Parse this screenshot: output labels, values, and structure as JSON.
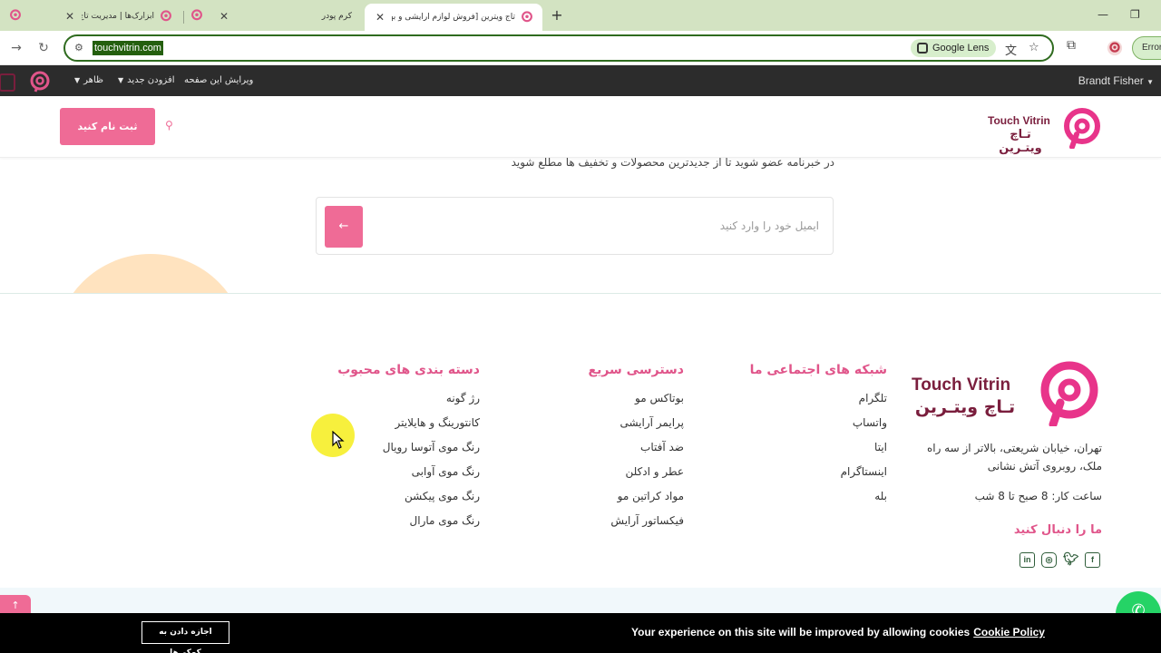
{
  "browser": {
    "tabs": [
      {
        "title": "ابزارک‌ها | مدیریت تاج ویترین",
        "active": false
      },
      {
        "title": "کرم پودر",
        "active": false
      },
      {
        "title": "تاج ویترین [فروش لوازم آرایشی و بهداشتی]",
        "active": true
      }
    ],
    "url": "touchvitrin.com",
    "lens_label": "Google Lens",
    "error_label": "Error"
  },
  "adminbar": {
    "appearance": "ظاهر",
    "add_new": "افزودن جدید",
    "edit_page": "ویرایش این صفحه",
    "user": "Brandt Fisher"
  },
  "header": {
    "brand_en": "Touch Vitrin",
    "brand_fa": "تـاچ ویتـرین",
    "register_label": "ثبت نام کنید"
  },
  "newsletter": {
    "text": "در خبرنامه عضو شوید تا از جدیدترین محصولات و تخفیف ها مطلع شوید",
    "placeholder": "ایمیل خود را وارد کنید",
    "submit_icon": "arrow-left"
  },
  "footer": {
    "brand_en": "Touch Vitrin",
    "brand_fa": "تـاچ ویتـرین",
    "address": "تهران، خیابان شریعتی، بالاتر از سه راه ملک، روبروی آتش نشانی",
    "hours": "ساعت کار: 8 صبح تا 8 شب",
    "follow_title": "ما را دنبال کنید",
    "socials": [
      "facebook",
      "twitter",
      "instagram",
      "linkedin"
    ],
    "columns": [
      {
        "title": "شبکه های اجتماعی ما",
        "items": [
          "تلگرام",
          "واتساپ",
          "ایتا",
          "اینستاگرام",
          "بله"
        ]
      },
      {
        "title": "دسترسی سریع",
        "items": [
          "بوتاکس مو",
          "پرایمر آرایشی",
          "ضد آفتاب",
          "عطر و ادکلن",
          "مواد کراتین مو",
          "فیکساتور آرایش"
        ]
      },
      {
        "title": "دسته بندی های محبوب",
        "items": [
          "رژ گونه",
          "کانتورینگ و هایلایتر",
          "رنگ موی آتوسا رویال",
          "رنگ موی آوابی",
          "رنگ موی پیکشن",
          "رنگ موی مارال"
        ]
      }
    ]
  },
  "cookie": {
    "message": "Your experience on this site will be improved by allowing cookies",
    "policy_link": "Cookie Policy",
    "accept_label": "اجازه دادن به کوکی‌ها"
  },
  "colors": {
    "accent": "#ef6b96",
    "brand": "#7a1e3d",
    "heading": "#e0558a"
  }
}
